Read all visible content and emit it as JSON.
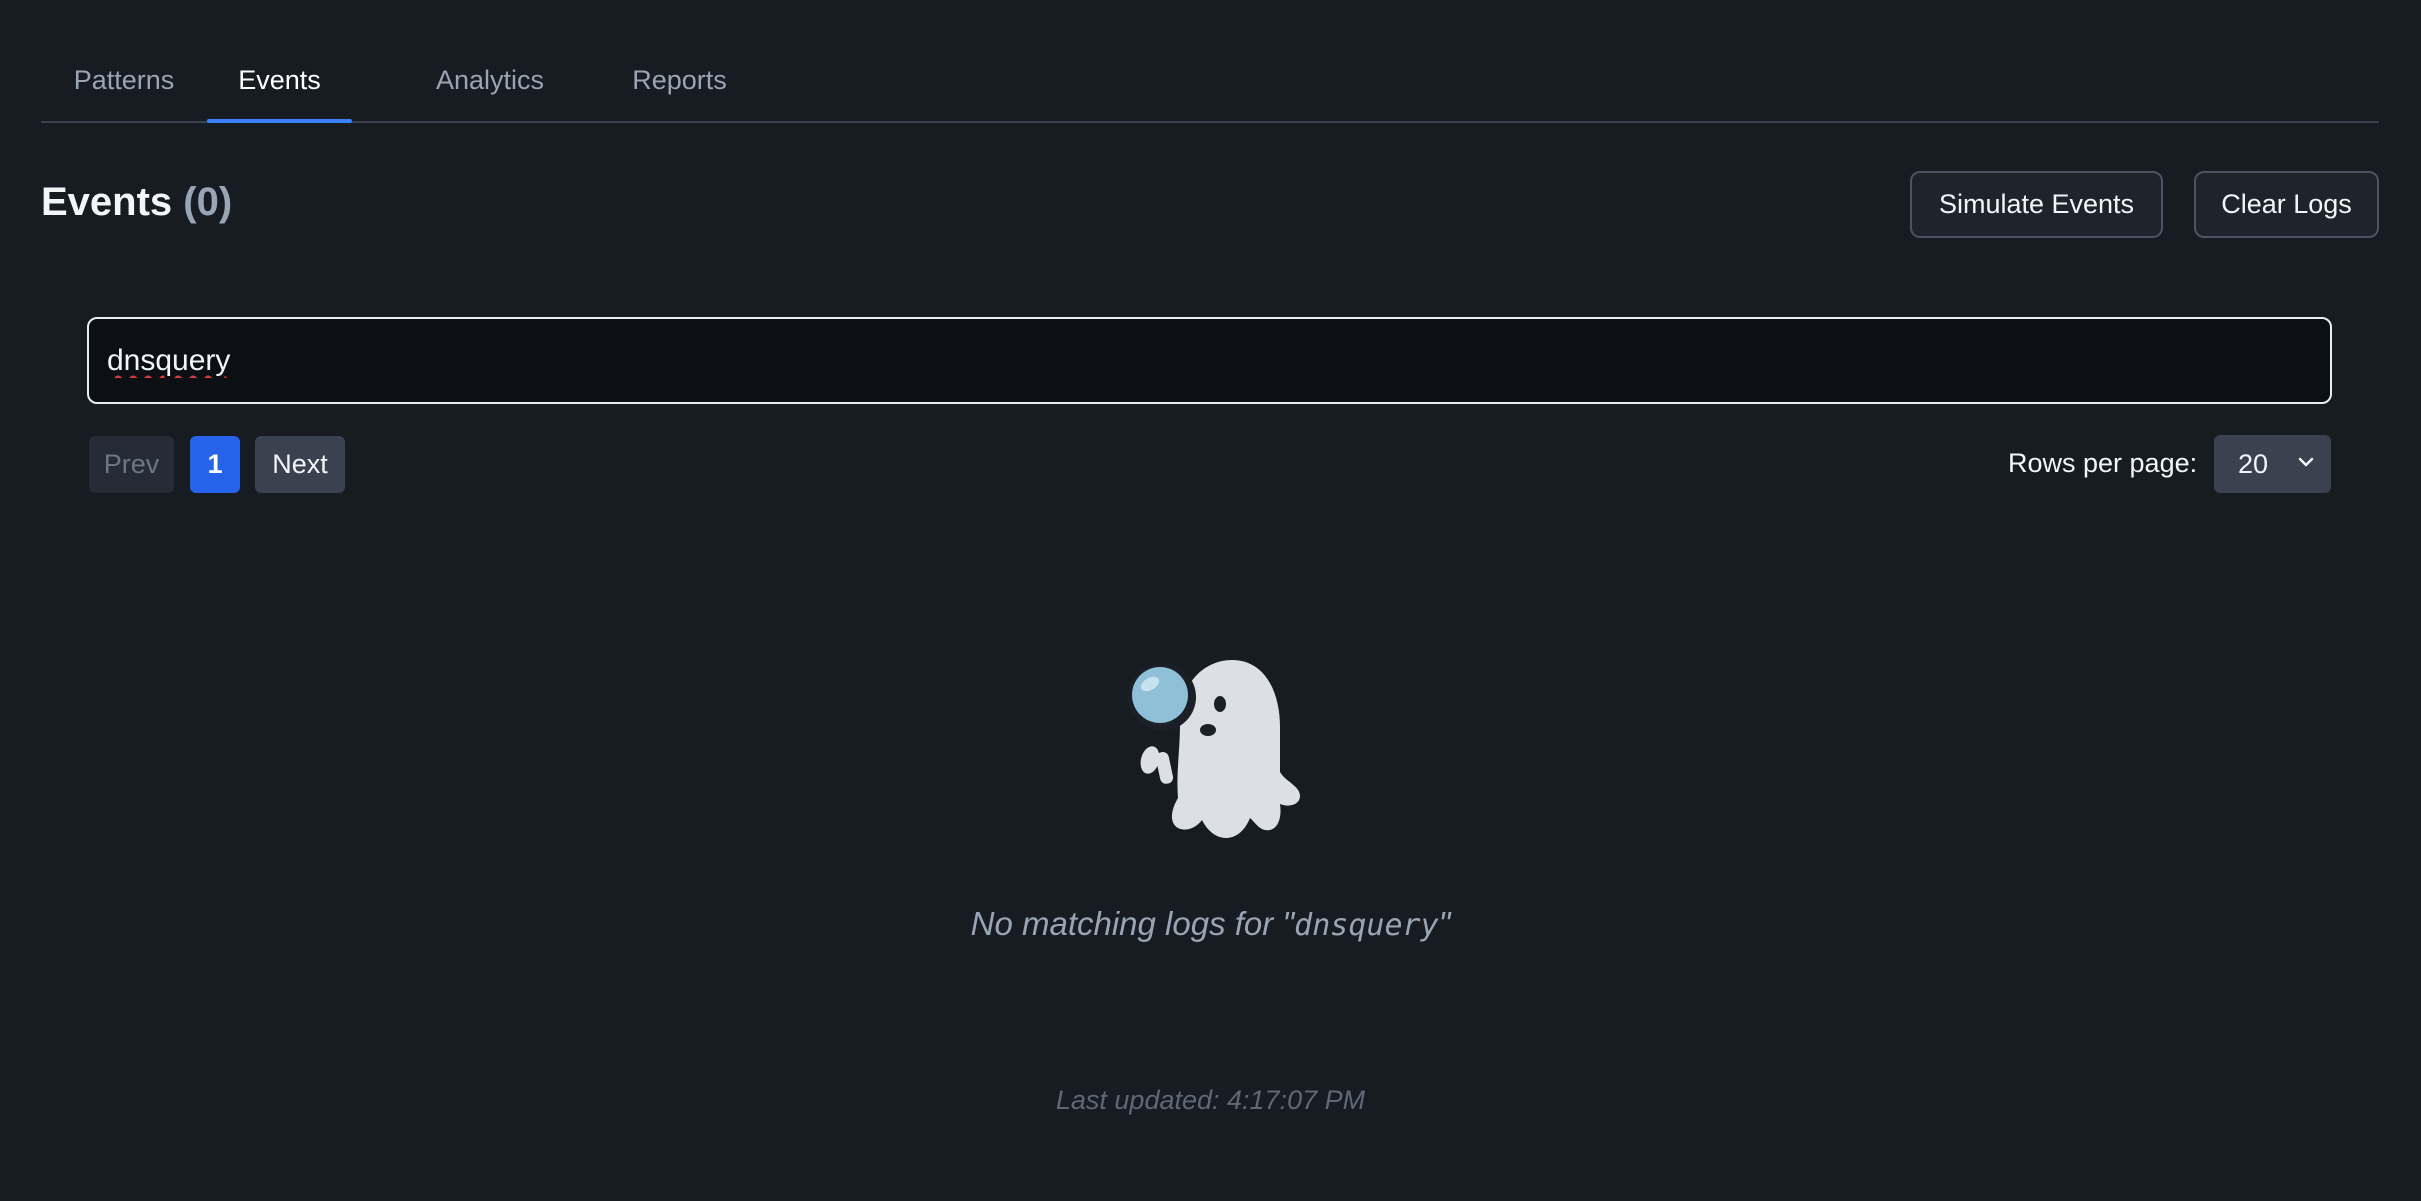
{
  "tabs": [
    {
      "label": "Patterns",
      "active": false
    },
    {
      "label": "Events",
      "active": true
    },
    {
      "label": "Analytics",
      "active": false
    },
    {
      "label": "Reports",
      "active": false
    }
  ],
  "header": {
    "title": "Events",
    "count": "(0)",
    "simulate_label": "Simulate Events",
    "clear_label": "Clear Logs"
  },
  "search": {
    "value": "dnsquery"
  },
  "pagination": {
    "prev_label": "Prev",
    "current_page": "1",
    "next_label": "Next",
    "rows_label": "Rows per page:",
    "rows_value": "20"
  },
  "empty_state": {
    "icon": "ghost-magnifier-icon",
    "message_prefix": "No matching logs for \"",
    "query": "dnsquery",
    "message_suffix": "\""
  },
  "footer": {
    "last_updated": "Last updated: 4:17:07 PM"
  },
  "colors": {
    "background": "#171b22",
    "accent": "#3b82f6",
    "active_page": "#2563eb"
  }
}
